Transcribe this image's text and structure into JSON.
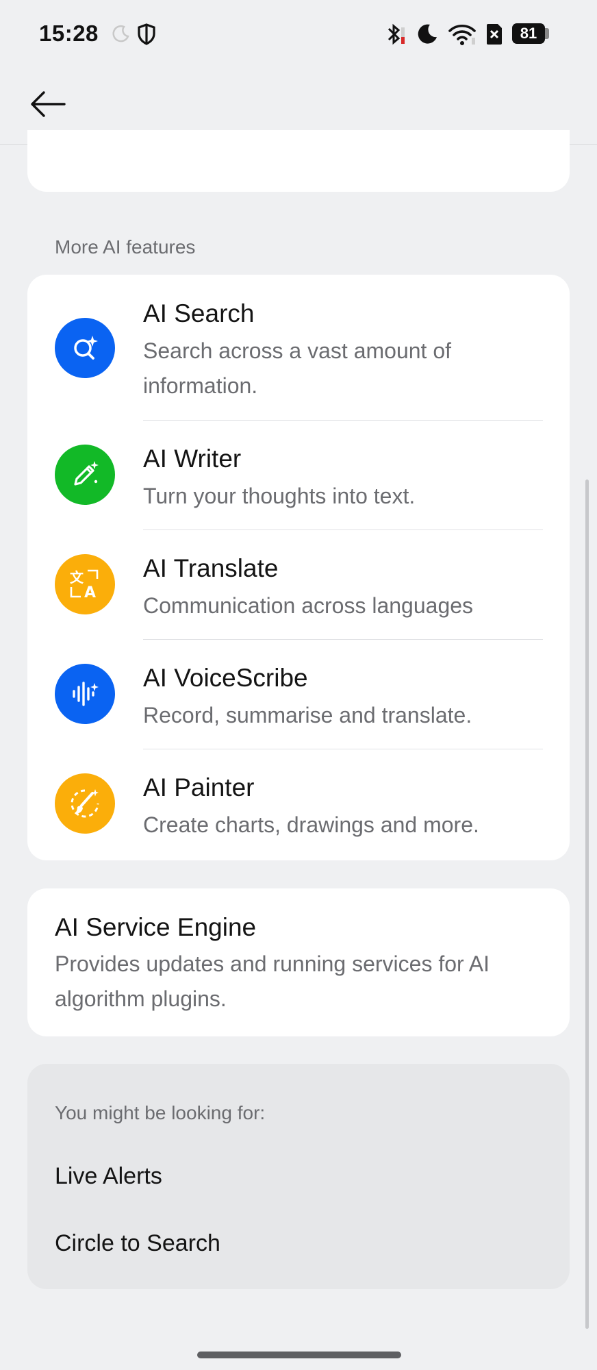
{
  "status_bar": {
    "time": "15:28",
    "battery_level": "81",
    "left_icons": [
      "moon-crescent-outline-icon",
      "shield-icon"
    ],
    "right_icons": [
      "bluetooth-icon",
      "do-not-disturb-moon-icon",
      "wifi-icon",
      "sim-x-icon",
      "battery-icon"
    ]
  },
  "app_bar": {
    "back_icon": "arrow-left-icon"
  },
  "section_header": "More AI features",
  "features": [
    {
      "title": "AI Search",
      "desc": "Search across a vast amount of information.",
      "icon": "sparkle-search-icon",
      "color": "#0a63f2"
    },
    {
      "title": "AI Writer",
      "desc": "Turn your thoughts into text.",
      "icon": "pencil-sparkle-icon",
      "color": "#12b927"
    },
    {
      "title": "AI Translate",
      "desc": "Communication across languages",
      "icon": "translate-icon",
      "color": "#fbae0a"
    },
    {
      "title": "AI VoiceScribe",
      "desc": "Record, summarise and translate.",
      "icon": "voice-waveform-icon",
      "color": "#0a63f2"
    },
    {
      "title": "AI Painter",
      "desc": "Create charts, drawings and more.",
      "icon": "paint-brush-icon",
      "color": "#fbae0a"
    }
  ],
  "engine": {
    "title": "AI Service Engine",
    "desc": "Provides updates and running services for AI algorithm plugins."
  },
  "suggestions": {
    "header": "You might be looking for:",
    "items": [
      "Live Alerts",
      "Circle to Search"
    ]
  }
}
